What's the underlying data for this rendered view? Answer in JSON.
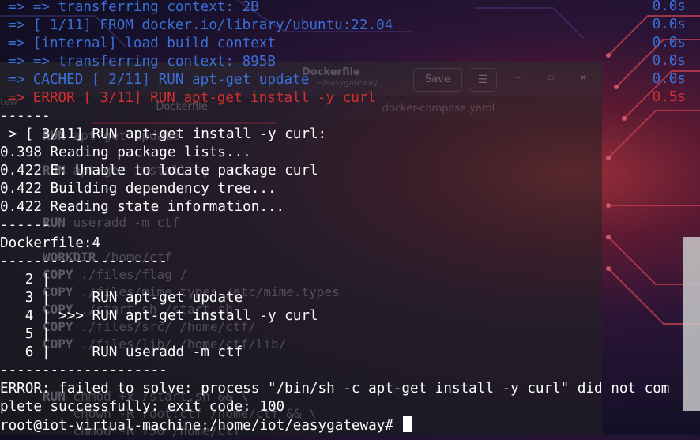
{
  "colors": {
    "terminal_text": "#ffffff",
    "build_step": "#3b6fd6",
    "error": "#d32f2f",
    "background": "#141028",
    "editor_window": "#232323"
  },
  "editor": {
    "title": "Dockerfile",
    "subtitle": "~/easygateway",
    "save_label": "Save",
    "menu_icon": "hamburger-icon",
    "sidebar_text": "tew",
    "tabs": [
      "Dockerfile",
      "docker-compose.yaml"
    ],
    "code_lines": [
      {
        "kw": "RUN",
        "rest": " apt-get update"
      },
      {
        "kw": "RUN",
        "rest": " apt-get install -y curl"
      },
      {
        "kw": "RUN",
        "rest": " useradd -m ctf"
      },
      {
        "kw": "WORKDIR",
        "rest": " /home/ctf"
      },
      {
        "kw": "COPY",
        "rest": " ./files/flag /"
      },
      {
        "kw": "COPY",
        "rest": " ./files/mime.types /etc/mime.types"
      },
      {
        "kw": "COPY",
        "rest": " ./start.sh /start.sh"
      },
      {
        "kw": "COPY",
        "rest": " ./files/src/ /home/ctf/"
      },
      {
        "kw": "COPY",
        "rest": " ./files/lib/ /home/ctf/lib/"
      },
      {
        "kw": "RUN",
        "rest": " chmod +x /start.sh && \\"
      },
      {
        "kw": "",
        "rest": "    chown -R root:ctf /home/ctf && \\"
      },
      {
        "kw": "",
        "rest": "    chmod -R 750 /home/ctf"
      }
    ]
  },
  "terminal": {
    "build_steps": [
      {
        "text": "=> => transferring context: 2B",
        "time": "0.0s"
      },
      {
        "text": "=> [ 1/11] FROM docker.io/library/ubuntu:22.04",
        "time": "0.0s"
      },
      {
        "text": "=> [internal] load build context",
        "time": "0.0s"
      },
      {
        "text": "=> => transferring context: 895B",
        "time": "0.0s"
      },
      {
        "text": "=> CACHED [ 2/11] RUN apt-get update",
        "time": "0.0s"
      }
    ],
    "error_step": {
      "text": "=> ERROR [ 3/11] RUN apt-get install -y curl",
      "time": "0.5s"
    },
    "output_lines": [
      "------",
      " > [ 3/11] RUN apt-get install -y curl:",
      "0.398 Reading package lists...",
      "0.422 E: Unable to locate package curl",
      "0.422 Building dependency tree...",
      "0.422 Reading state information...",
      "------",
      "Dockerfile:4",
      "--------------------",
      "   2 |",
      "   3 |     RUN apt-get update",
      "   4 | >>> RUN apt-get install -y curl",
      "   5 |",
      "   6 |     RUN useradd -m ctf",
      "--------------------",
      "ERROR: failed to solve: process \"/bin/sh -c apt-get install -y curl\" did not com",
      "plete successfully: exit code: 100"
    ],
    "prompt": "root@iot-virtual-machine:/home/iot/easygateway# "
  }
}
